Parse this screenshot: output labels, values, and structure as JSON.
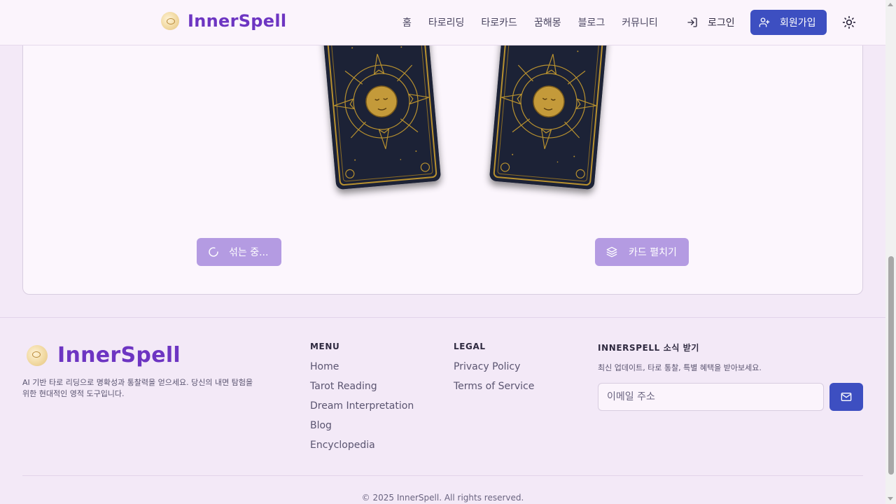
{
  "header": {
    "brand": "InnerSpell",
    "nav": [
      "홈",
      "타로리딩",
      "타로카드",
      "꿈해몽",
      "블로그",
      "커뮤니티"
    ],
    "login_label": "로그인",
    "signup_label": "회원가입"
  },
  "main": {
    "cards": [
      {
        "name": "tarot-card-back-left"
      },
      {
        "name": "tarot-card-back-right"
      }
    ],
    "shuffle_label": "섞는 중...",
    "spread_label": "카드 펼치기"
  },
  "footer": {
    "brand": "InnerSpell",
    "description": "AI 기반 타로 리딩으로 명확성과 통찰력을 얻으세요. 당신의 내면 탐험을 위한 현대적인 영적 도구입니다.",
    "menu": {
      "title": "MENU",
      "items": [
        "Home",
        "Tarot Reading",
        "Dream Interpretation",
        "Blog",
        "Encyclopedia"
      ]
    },
    "legal": {
      "title": "LEGAL",
      "items": [
        "Privacy Policy",
        "Terms of Service"
      ]
    },
    "newsletter": {
      "title": "INNERSPELL 소식 받기",
      "description": "최신 업데이트, 타로 통찰, 특별 혜택을 받아보세요.",
      "email_placeholder": "이메일 주소"
    },
    "copyright": "© 2025 InnerSpell. All rights reserved."
  },
  "colors": {
    "brand_purple": "#6d35c2",
    "primary_blue": "#3d4fc1",
    "disabled_purple": "#b49be2",
    "card_navy": "#1c2236",
    "card_gold": "#b8912f"
  }
}
